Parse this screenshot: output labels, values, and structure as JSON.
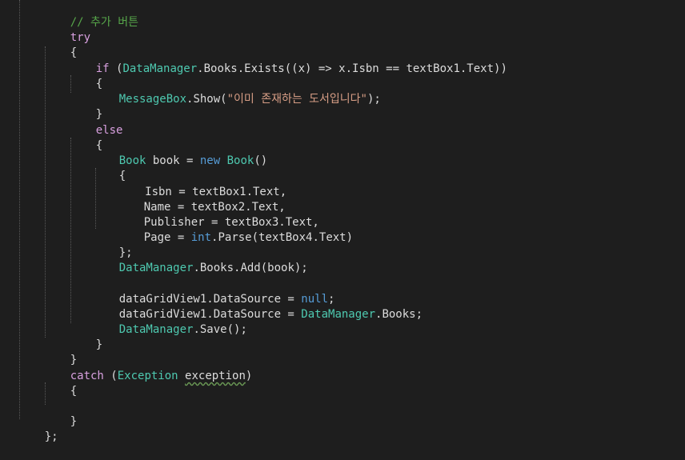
{
  "editor": {
    "comment": "// 추가 버튼",
    "kw_try": "try",
    "brace_open": "{",
    "brace_close": "}",
    "kw_if": "if",
    "if_open_paren": " (",
    "if_datamanager": "DataManager",
    "if_rest": ".Books.Exists((x) => x.Isbn == textBox1.Text))",
    "msg_type": "MessageBox",
    "msg_call": ".Show(",
    "msg_string": "\"이미 존재하는 도서입니다\"",
    "msg_end": ");",
    "kw_else": "else",
    "book_type": "Book",
    "book_var": " book = ",
    "kw_new": "new",
    "book_ctor": " Book",
    "book_ctor_end": "()",
    "isbn_assign": " Isbn = textBox1.Text,",
    "name_assign": "Name = textBox2.Text,",
    "publisher_assign": "Publisher = textBox3.Text,",
    "page_assign_start": "Page = ",
    "kw_int": "int",
    "page_assign_end": ".Parse(textBox4.Text)",
    "init_close": "};",
    "add_type": "DataManager",
    "add_call": ".Books.Add(book);",
    "dgv_null_start": "dataGridView1.DataSource = ",
    "kw_null": "null",
    "semicolon": ";",
    "dgv_books_start": "dataGridView1.DataSource = ",
    "dgv_books_type": "DataManager",
    "dgv_books_end": ".Books;",
    "save_type": "DataManager",
    "save_call": ".Save();",
    "kw_catch": "catch",
    "catch_open": " (",
    "exception_type": "Exception",
    "exception_var": "exception",
    "catch_close": ")",
    "final_close": "};"
  },
  "colors": {
    "background": "#1e1e1e",
    "keyword": "#569cd6",
    "control_keyword": "#d8a0df",
    "type": "#4ec9b0",
    "string": "#d69d85",
    "comment": "#57a64a",
    "plain": "#dcdcdc"
  }
}
